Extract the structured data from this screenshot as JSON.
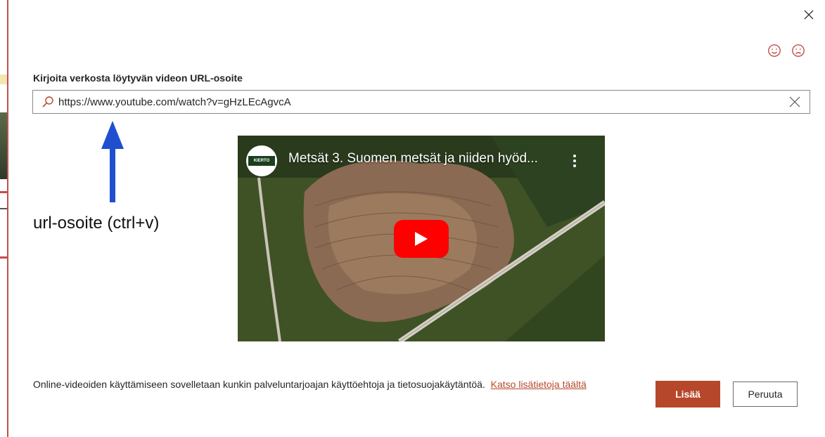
{
  "dialog": {
    "url_label": "Kirjoita verkosta löytyvän videon URL-osoite",
    "url_value": "https://www.youtube.com/watch?v=gHzLEcAgvcA",
    "close_icon": "close-icon",
    "feedback": {
      "smile_icon": "smile-icon",
      "frown_icon": "frown-icon"
    }
  },
  "annotation": {
    "text": "url-osoite (ctrl+v)",
    "arrow_color": "#1f4fd1"
  },
  "video": {
    "title": "Metsät 3. Suomen metsät ja niiden hyöd...",
    "channel_logo_text": "KIERTO TALOUS.nyt",
    "play_icon": "play-icon",
    "menu_icon": "kebab-menu-icon"
  },
  "footer": {
    "terms_text": "Online-videoiden käyttämiseen sovelletaan kunkin palveluntarjoajan käyttöehtoja ja tietosuojakäytäntöä.",
    "link_text": "Katso lisätietoja täältä",
    "insert_button": "Lisää",
    "cancel_button": "Peruuta"
  },
  "colors": {
    "accent": "#b7472a",
    "feedback_icon": "#c0504d",
    "youtube_red": "#ff0000"
  }
}
